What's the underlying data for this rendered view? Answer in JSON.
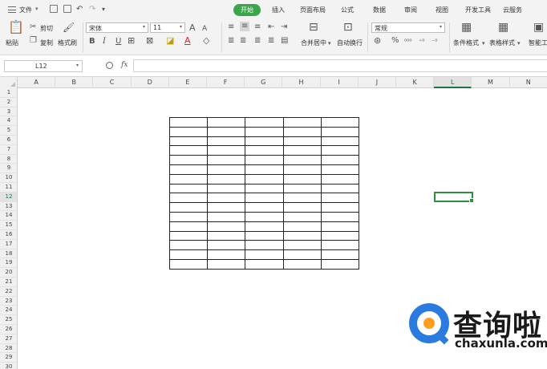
{
  "menubar": {
    "file_label": "文件",
    "tabs": [
      {
        "label": "开始",
        "active": true
      },
      {
        "label": "插入",
        "active": false
      },
      {
        "label": "页面布局",
        "active": false
      },
      {
        "label": "公式",
        "active": false
      },
      {
        "label": "数据",
        "active": false
      },
      {
        "label": "审阅",
        "active": false
      },
      {
        "label": "视图",
        "active": false
      },
      {
        "label": "开发工具",
        "active": false
      },
      {
        "label": "云服务",
        "active": false
      }
    ]
  },
  "ribbon": {
    "paste_label": "粘贴",
    "cut_label": "剪切",
    "copy_label": "复制",
    "format_painter_label": "格式刷",
    "font_name": "宋体",
    "font_size": "11",
    "merge_label": "合并居中",
    "wrap_label": "自动换行",
    "number_format": "常规",
    "conditional_format_label": "条件格式",
    "table_style_label": "表格样式",
    "smart_label": "智能工",
    "grow_font": "A",
    "shrink_font": "A",
    "bold": "B",
    "italic": "I",
    "underline": "U",
    "percent": "%",
    "font_color_glyph": "A"
  },
  "formula_bar": {
    "name_box": "L12",
    "fx": "fx",
    "content": ""
  },
  "sheet": {
    "columns": [
      "A",
      "B",
      "C",
      "D",
      "E",
      "F",
      "G",
      "H",
      "I",
      "J",
      "K",
      "L",
      "M",
      "N"
    ],
    "rows": [
      "1",
      "2",
      "3",
      "4",
      "5",
      "6",
      "7",
      "8",
      "9",
      "10",
      "11",
      "12",
      "13",
      "14",
      "15",
      "16",
      "17",
      "18",
      "19",
      "20",
      "21",
      "22",
      "23",
      "24",
      "25",
      "26",
      "27",
      "28",
      "29",
      "30"
    ],
    "selected_cell": "L12",
    "selected_column": "L",
    "selected_row": "12",
    "table_range": "E4:I19"
  },
  "watermark": {
    "cn": "查询啦",
    "en": "chaxunla.com"
  },
  "colors": {
    "accent": "#3aa54a",
    "selection": "#2f8f3f"
  }
}
